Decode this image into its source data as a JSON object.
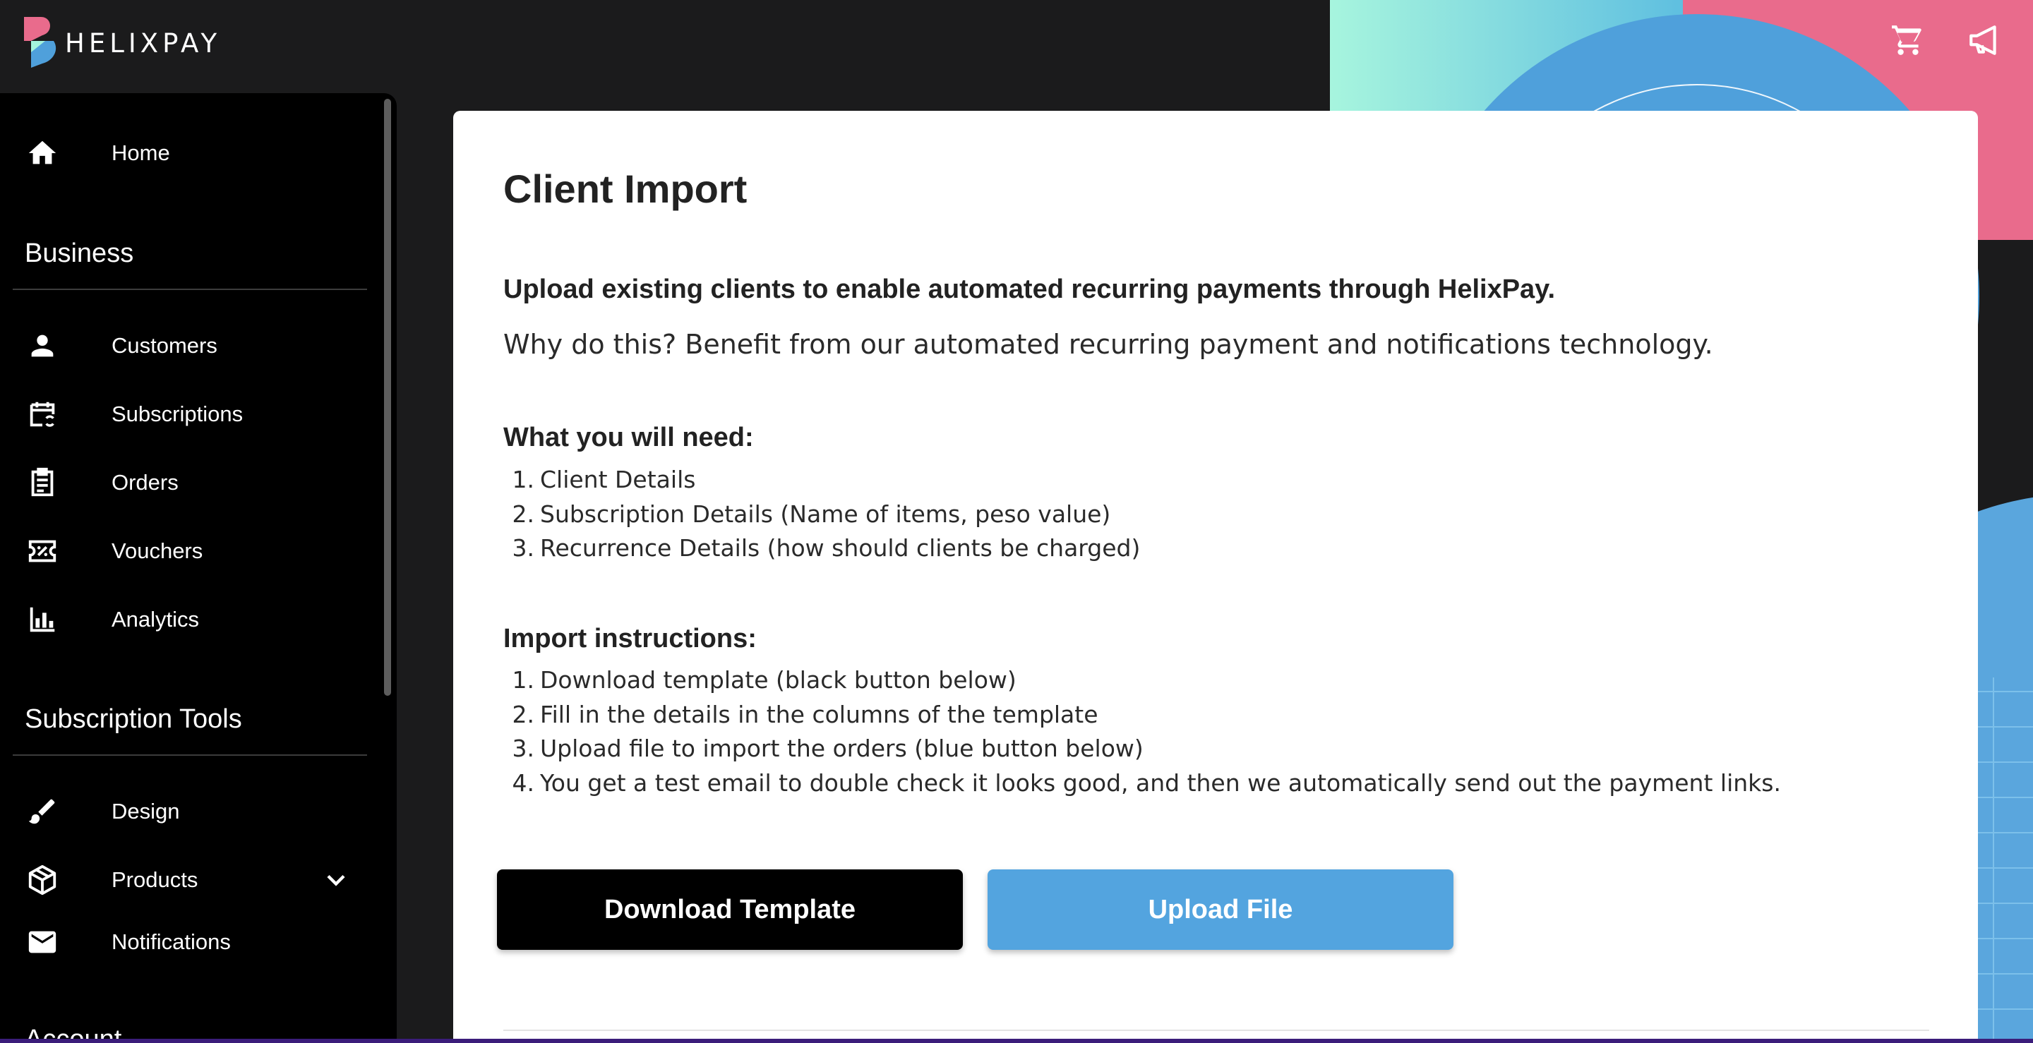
{
  "brand": {
    "name": "HELIXPAY"
  },
  "topbar": {
    "icons": [
      "cart-icon",
      "megaphone-icon"
    ]
  },
  "sidebar": {
    "home": {
      "label": "Home"
    },
    "sections": [
      {
        "title": "Business",
        "items": [
          {
            "label": "Customers",
            "icon": "person-icon"
          },
          {
            "label": "Subscriptions",
            "icon": "calendar-sync-icon"
          },
          {
            "label": "Orders",
            "icon": "clipboard-icon"
          },
          {
            "label": "Vouchers",
            "icon": "voucher-icon"
          },
          {
            "label": "Analytics",
            "icon": "bar-chart-icon"
          }
        ]
      },
      {
        "title": "Subscription Tools",
        "items": [
          {
            "label": "Design",
            "icon": "brush-icon"
          },
          {
            "label": "Products",
            "icon": "box-icon"
          },
          {
            "label": "Notifications",
            "icon": "mail-icon"
          }
        ]
      }
    ],
    "next_section_partial": "Account"
  },
  "main": {
    "title": "Client Import",
    "lead": "Upload existing clients to enable automated recurring payments through HelixPay.",
    "why": "Why do this? Benefit from our automated recurring payment and notifications technology.",
    "need": {
      "heading": "What you will need:",
      "items": [
        "Client Details",
        "Subscription Details (Name of items, peso value)",
        "Recurrence Details (how should clients be charged)"
      ]
    },
    "instructions": {
      "heading": "Import instructions:",
      "items": [
        "Download template (black button below)",
        "Fill in the details in the columns of the template",
        "Upload file to import the orders (blue button below)",
        "You get a test email to double check it looks good, and then we automatically send out the payment links."
      ]
    },
    "buttons": {
      "download": "Download Template",
      "upload": "Upload File"
    }
  },
  "colors": {
    "accent_blue": "#53a4df",
    "brand_pink": "#e96b8c",
    "brand_mint": "#a4f3dc",
    "background": "#1b1b1c"
  }
}
